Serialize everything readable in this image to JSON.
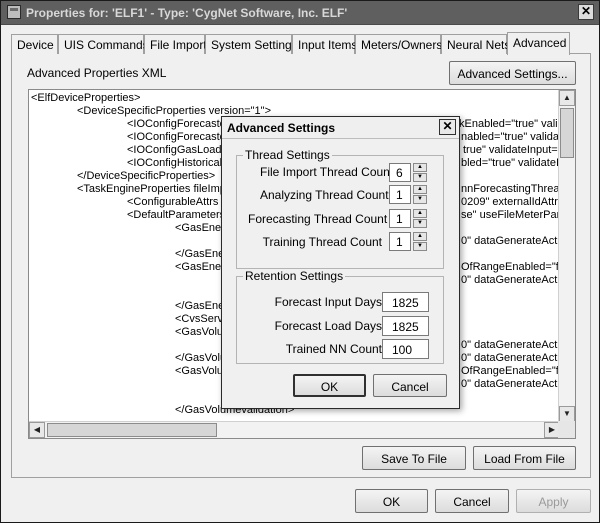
{
  "window": {
    "title": "Properties for: 'ELF1' - Type: 'CygNet Software, Inc. ELF'",
    "close_glyph": "✕"
  },
  "tabs": [
    "Device",
    "UIS Commands",
    "File Import",
    "System Settings",
    "Input Items",
    "Meters/Owners",
    "Neural Nets",
    "Advanced"
  ],
  "active_tab": "Advanced",
  "advanced": {
    "section_label": "Advanced Properties XML",
    "settings_button": "Advanced Settings...",
    "save_button": "Save To File",
    "load_button": "Load From File"
  },
  "xml_lines": [
    "<ElfDeviceProperties>",
    "<DeviceSpecificProperties version=\"1\">",
    "<IOConfigForecastec",
    "<IOConfigForecastec",
    "<IOConfigGasLoad e",
    "<IOConfigHistoricalIr",
    "</DeviceSpecificProperties>",
    "<TaskEngineProperties fileImpo",
    "<ConfigurableAttrs de",
    "<DefaultParameters",
    "<GasEnei",
    "</GasEne",
    "<GasEnei",
    "</GasEne",
    "<CvsServi",
    "<GasVolu",
    "</GasVolu",
    "<GasVolu",
    "</GasVolumevalidation>"
  ],
  "xml_right_fragments": [
    "kEnabled=\"true\" vali",
    "nabled=\"true\" validat",
    "true\" validateInput=\"",
    "bled=\"true\" validateIn",
    "nnForecastingThread",
    "0209\" externalIdAttr=",
    "se\" useFileMeterPar",
    "0\" dataGenerateActi",
    "OfRangeEnabled=\"fa",
    "0\" dataGenerateActi",
    "0\" dataGenerateActi",
    "0\" dataGenerateActi",
    "OfRangeEnabled=\"fa",
    "0\" dataGenerateActi"
  ],
  "dialog": {
    "title": "Advanced Settings",
    "close_glyph": "✕",
    "thread_group_label": "Thread Settings",
    "thread_settings": [
      {
        "label": "File Import Thread Count",
        "value": "6"
      },
      {
        "label": "Analyzing Thread Count",
        "value": "1"
      },
      {
        "label": "Forecasting Thread Count",
        "value": "1"
      },
      {
        "label": "Training Thread Count",
        "value": "1"
      }
    ],
    "retention_group_label": "Retention Settings",
    "retention_settings": [
      {
        "label": "Forecast Input Days",
        "value": "1825"
      },
      {
        "label": "Forecast Load Days",
        "value": "1825"
      },
      {
        "label": "Trained NN Count",
        "value": "100"
      }
    ],
    "ok_button": "OK",
    "cancel_button": "Cancel"
  },
  "footer": {
    "ok_button": "OK",
    "cancel_button": "Cancel",
    "apply_button": "Apply"
  },
  "scroll_glyphs": {
    "up": "▲",
    "down": "▼",
    "left": "◀",
    "right": "▶"
  }
}
